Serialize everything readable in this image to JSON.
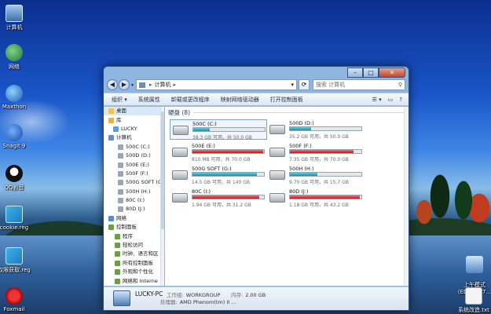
{
  "desktop": {
    "icons_left": [
      {
        "label": "计算机",
        "icon": "computer-icon"
      },
      {
        "label": "网络",
        "icon": "network-icon"
      },
      {
        "label": "Maxthon",
        "icon": "maxthon-icon"
      },
      {
        "label": "Snagit 9",
        "icon": "snagit-icon"
      },
      {
        "label": "QQ影音",
        "icon": "qq-player-icon"
      },
      {
        "label": "cookie.reg",
        "icon": "reg-file-icon"
      },
      {
        "label": "权限获取.reg",
        "icon": "reg-file-icon"
      },
      {
        "label": "Foxmail",
        "icon": "foxmail-icon"
      }
    ],
    "icons_right": [
      {
        "label": "上午模式\n(ED7BA47...",
        "icon": "computer-shortcut-icon"
      },
      {
        "label": "系统改造.txt",
        "icon": "text-file-icon"
      }
    ]
  },
  "window": {
    "titlebar": {
      "minimize": "–",
      "maximize": "□",
      "close": "✕"
    },
    "address": {
      "crumbs": [
        "计算机"
      ],
      "search_placeholder": "搜索 计算机"
    },
    "toolbar": {
      "items": [
        "组织 ▾",
        "系统属性",
        "卸载或更改程序",
        "映射网络驱动器",
        "打开控制面板"
      ],
      "right": [
        "☰ ▾",
        "▭",
        "?"
      ]
    },
    "nav_pane": {
      "items": [
        {
          "label": "桌面",
          "icon": "ni-fav",
          "name": "desktop",
          "selected": true
        },
        {
          "label": "库",
          "icon": "ni-lib",
          "name": "library"
        },
        {
          "label": "LUCKY",
          "icon": "ni-user",
          "name": "lucky"
        },
        {
          "label": "计算机",
          "icon": "ni-pc",
          "name": "computer"
        },
        {
          "label": "500C (C:)",
          "icon": "ni-drive",
          "name": "drive-c"
        },
        {
          "label": "500D (D:)",
          "icon": "ni-drive",
          "name": "drive-d"
        },
        {
          "label": "500E (E:)",
          "icon": "ni-drive",
          "name": "drive-e"
        },
        {
          "label": "500F (F:)",
          "icon": "ni-drive",
          "name": "drive-f"
        },
        {
          "label": "500G SOFT (G:)",
          "icon": "ni-drive",
          "name": "drive-g"
        },
        {
          "label": "500H (H:)",
          "icon": "ni-drive",
          "name": "drive-h"
        },
        {
          "label": "80C (I:)",
          "icon": "ni-drive",
          "name": "drive-i"
        },
        {
          "label": "80D (J:)",
          "icon": "ni-drive",
          "name": "drive-j"
        },
        {
          "label": "网络",
          "icon": "ni-net",
          "name": "network"
        },
        {
          "label": "控制面板",
          "icon": "ni-cp",
          "name": "control-panel"
        },
        {
          "label": "程序",
          "icon": "ni-cp",
          "name": "programs"
        },
        {
          "label": "轻松访问",
          "icon": "ni-cp",
          "name": "ease-of-access"
        },
        {
          "label": "时钟、语言和区",
          "icon": "ni-cp",
          "name": "clock-language"
        },
        {
          "label": "所有控制面板",
          "icon": "ni-cp",
          "name": "all-cp-items"
        },
        {
          "label": "外观和个性化",
          "icon": "ni-cp",
          "name": "appearance"
        },
        {
          "label": "网络和 Interne",
          "icon": "ni-cp",
          "name": "network-internet"
        }
      ]
    },
    "content": {
      "group_title": "硬盘 (8)",
      "drives": [
        {
          "name": "500C (C:)",
          "free_text": "38.3 GB 可用，共 50.0 GB",
          "used_fraction": 0.234,
          "full": false,
          "selected": true
        },
        {
          "name": "500D (D:)",
          "free_text": "35.2 GB 可用，共 50.0 GB",
          "used_fraction": 0.296,
          "full": false
        },
        {
          "name": "500E (E:)",
          "free_text": "810 MB 可用，共 70.0 GB",
          "used_fraction": 0.989,
          "full": true
        },
        {
          "name": "500F (F:)",
          "free_text": "7.35 GB 可用，共 70.0 GB",
          "used_fraction": 0.895,
          "full": true
        },
        {
          "name": "500G SOFT (G:)",
          "free_text": "14.5 GB 可用，共 140 GB",
          "used_fraction": 0.896,
          "full": false
        },
        {
          "name": "500H (H:)",
          "free_text": "9.70 GB 可用，共 15.7 GB",
          "used_fraction": 0.382,
          "full": false
        },
        {
          "name": "80C (I:)",
          "free_text": "1.94 GB 可用，共 31.2 GB",
          "used_fraction": 0.938,
          "full": true
        },
        {
          "name": "80D (J:)",
          "free_text": "1.18 GB 可用，共 43.2 GB",
          "used_fraction": 0.973,
          "full": true
        }
      ]
    },
    "details": {
      "pc_name": "LUCKY-PC",
      "workgroup_label": "工作组:",
      "workgroup": "WORKGROUP",
      "memory_label": "内存:",
      "memory": "2.00 GB",
      "cpu_label": "处理器:",
      "cpu": "AMD Phenom(tm) II ..."
    }
  }
}
